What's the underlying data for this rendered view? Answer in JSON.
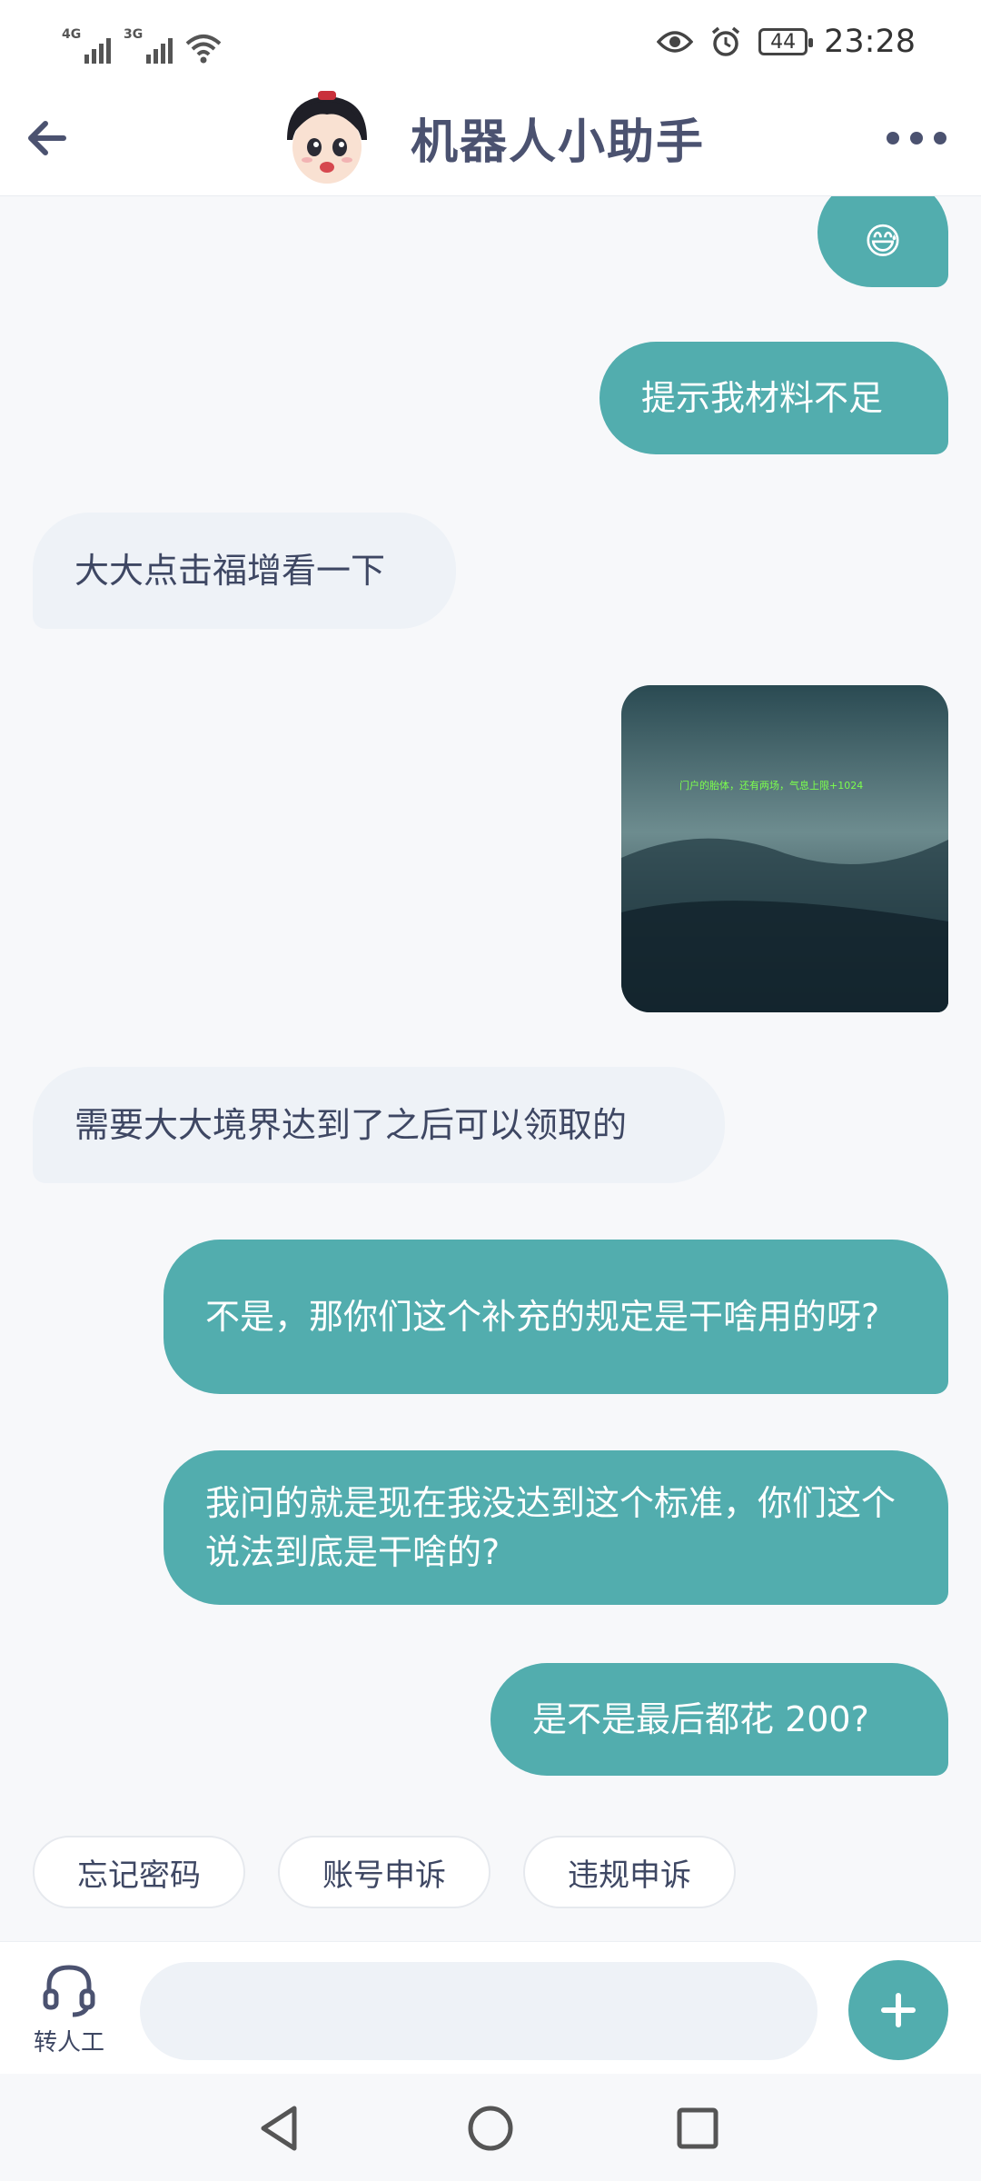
{
  "status_bar": {
    "signal1_tag": "4G",
    "signal2_tag": "3G",
    "battery_level": "44",
    "time": "23:28"
  },
  "header": {
    "title": "机器人小助手",
    "back_icon": "arrow-left-icon",
    "more_icon": "more-dots-icon"
  },
  "messages": [
    {
      "from": "user",
      "type": "emoji",
      "text": "😅"
    },
    {
      "from": "user",
      "type": "text",
      "text": "提示我材料不足"
    },
    {
      "from": "bot",
      "type": "text",
      "text": "大大点击福增看一下"
    },
    {
      "from": "user",
      "type": "image",
      "caption": "门户的胎体，还有两场，气息上限+1024"
    },
    {
      "from": "bot",
      "type": "text",
      "text": "需要大大境界达到了之后可以领取的"
    },
    {
      "from": "user",
      "type": "text",
      "text": "不是，那你们这个补充的规定是干啥用的呀?"
    },
    {
      "from": "user",
      "type": "text",
      "text": "我问的就是现在我没达到这个标准，你们这个说法到底是干啥的?"
    },
    {
      "from": "user",
      "type": "text",
      "text": "是不是最后都花 200?"
    }
  ],
  "quick_replies": [
    "忘记密码",
    "账号申诉",
    "违规申诉"
  ],
  "input_bar": {
    "agent_label": "转人工",
    "input_value": "",
    "input_placeholder": "",
    "plus_icon": "plus-icon"
  },
  "nav_bar": {
    "back": "triangle-back-icon",
    "home": "circle-home-icon",
    "recents": "square-recents-icon"
  },
  "colors": {
    "user_bubble": "#52adae",
    "bot_bubble": "#eef2f7",
    "accent": "#52adae"
  }
}
